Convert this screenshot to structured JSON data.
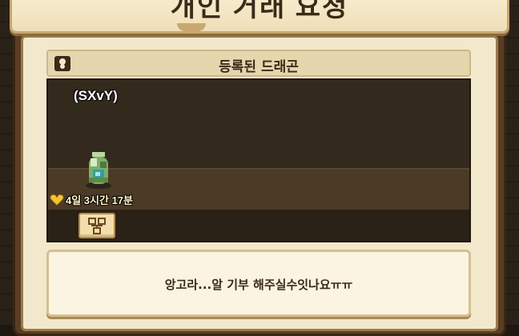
{
  "dialog": {
    "title": "개인 거래 요청"
  },
  "section": {
    "title": "등록된 드래곤"
  },
  "dragon": {
    "name": "(SXvY)",
    "timer": "4일 3시간 17분"
  },
  "message": {
    "text": "앙고라...알 기부 해주실수잇나요ㅠㅠ"
  },
  "colors": {
    "panel": "#f2e8cc",
    "frame": "#5a3d22",
    "habitat": "#33291d",
    "text": "#3b2a18",
    "heart": "#f2c230"
  }
}
